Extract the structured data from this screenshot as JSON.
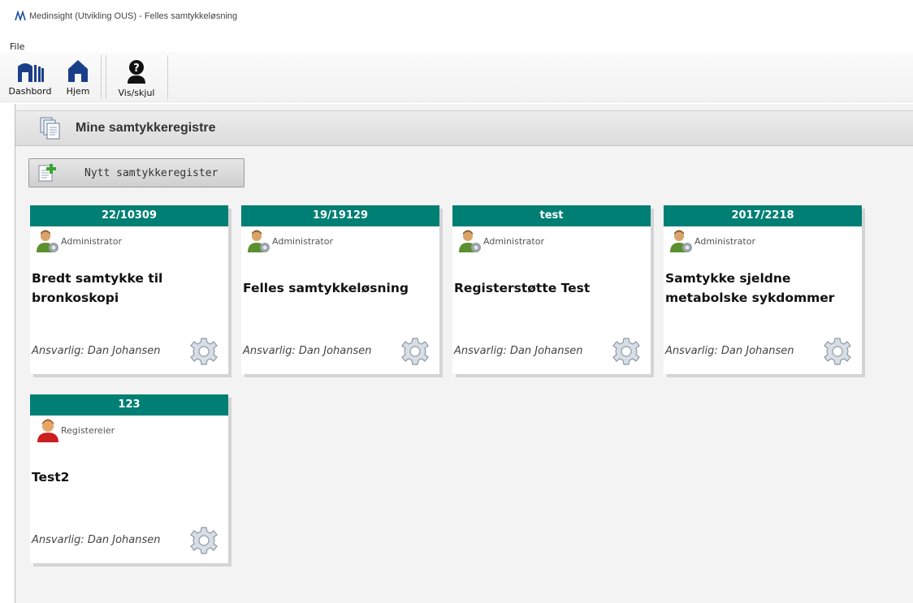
{
  "window": {
    "title": "Medinsight (Utvikling OUS) - Felles samtykkeløsning"
  },
  "menu": {
    "file_label": "File"
  },
  "toolbar": {
    "dashboard_label": "Dashbord",
    "home_label": "Hjem",
    "toggle_label": "Vis/skjul"
  },
  "panel": {
    "title": "Mine samtykkeregistre",
    "new_button_label": "Nytt samtykkeregister"
  },
  "colors": {
    "card_header": "#007f74",
    "panel_background": "#f3f3f3"
  },
  "cards": [
    {
      "id": "22/10309",
      "role": "Administrator",
      "role_icon": "administrator-icon",
      "name": "Bredt samtykke til bronkoskopi",
      "owner": "Ansvarlig: Dan Johansen"
    },
    {
      "id": "19/19129",
      "role": "Administrator",
      "role_icon": "administrator-icon",
      "name": "Felles samtykkeløsning",
      "owner": "Ansvarlig: Dan Johansen"
    },
    {
      "id": "test",
      "role": "Administrator",
      "role_icon": "administrator-icon",
      "name": "Registerstøtte Test",
      "owner": "Ansvarlig: Dan Johansen"
    },
    {
      "id": "2017/2218",
      "role": "Administrator",
      "role_icon": "administrator-icon",
      "name": "Samtykke sjeldne metabolske sykdommer",
      "owner": "Ansvarlig: Dan Johansen"
    },
    {
      "id": "123",
      "role": "Registereier",
      "role_icon": "register-owner-icon",
      "name": "Test2",
      "owner": "Ansvarlig: Dan Johansen"
    }
  ]
}
